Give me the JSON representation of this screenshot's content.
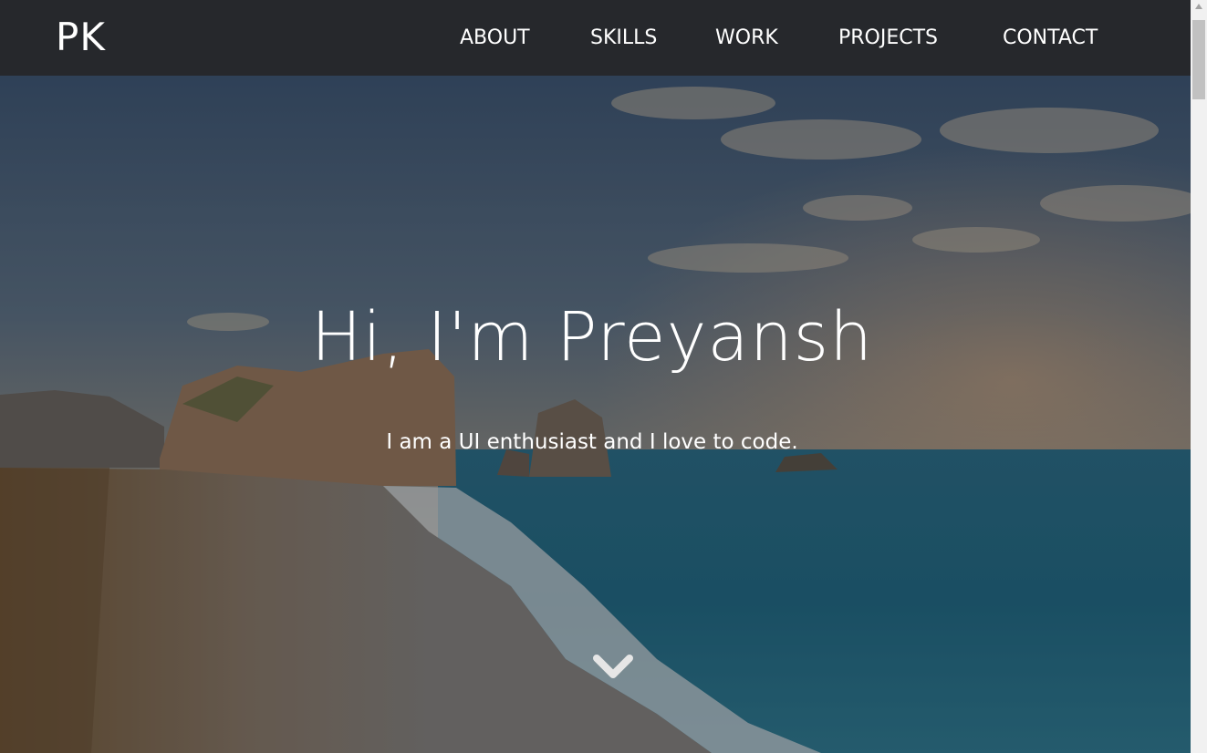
{
  "navbar": {
    "brand": "PK",
    "links": [
      {
        "label": "ABOUT"
      },
      {
        "label": "SKILLS"
      },
      {
        "label": "WORK"
      },
      {
        "label": "PROJECTS"
      },
      {
        "label": "CONTACT"
      }
    ],
    "background": "#26282c"
  },
  "hero": {
    "title": "Hi, I'm Preyansh",
    "subtitle": "I am a UI enthusiast and I love to code.",
    "scroll_icon": "chevron-down-icon"
  },
  "colors": {
    "text": "#ffffff",
    "sea": "#1c6a86",
    "sand": "#8a6d4a"
  }
}
